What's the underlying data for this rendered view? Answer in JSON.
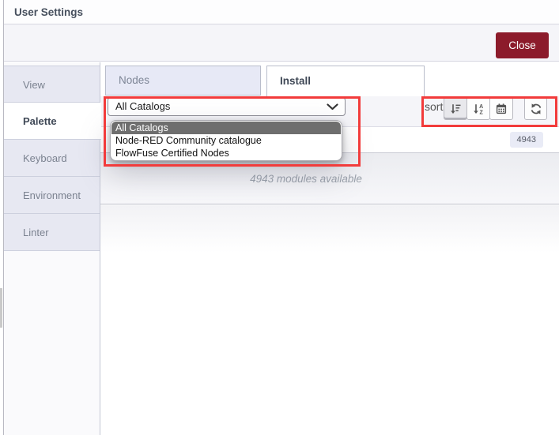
{
  "titlebar": {
    "title": "User Settings"
  },
  "header": {
    "close_label": "Close"
  },
  "sidebar": {
    "items": [
      {
        "label": "View",
        "active": false
      },
      {
        "label": "Palette",
        "active": true
      },
      {
        "label": "Keyboard",
        "active": false
      },
      {
        "label": "Environment",
        "active": false
      },
      {
        "label": "Linter",
        "active": false
      }
    ]
  },
  "palette_tabs": {
    "nodes_label": "Nodes",
    "install_label": "Install",
    "active_tab": "Install"
  },
  "toolbar": {
    "catalog_selected": "All Catalogs",
    "sort_label": "sort:",
    "sort_buttons": [
      "sort-amount-down",
      "sort-alpha-down",
      "calendar"
    ],
    "active_sort": "sort-amount-down",
    "refresh": "refresh"
  },
  "catalog_dropdown": {
    "options": [
      {
        "label": "All Catalogs",
        "selected": true
      },
      {
        "label": "Node-RED Community catalogue",
        "selected": false
      },
      {
        "label": "FlowFuse Certified Nodes",
        "selected": false
      }
    ]
  },
  "install": {
    "count_badge": "4943",
    "modules_available": "4943 modules available"
  },
  "icons": {
    "chevron": "chevron-down-icon",
    "sort_amount": "sort-amount-down-icon",
    "sort_alpha": "sort-alpha-down-icon",
    "calendar": "calendar-icon",
    "refresh": "refresh-icon"
  },
  "colors": {
    "annotation_red": "#f23b3b",
    "close_button_bg": "#8c1b2b",
    "dropdown_highlight": "#6e6e6e",
    "sidebar_tab_bg": "#e7e8f2",
    "toolbar_bg": "#f5f5f9",
    "badge_bg": "#e9ebf6"
  }
}
